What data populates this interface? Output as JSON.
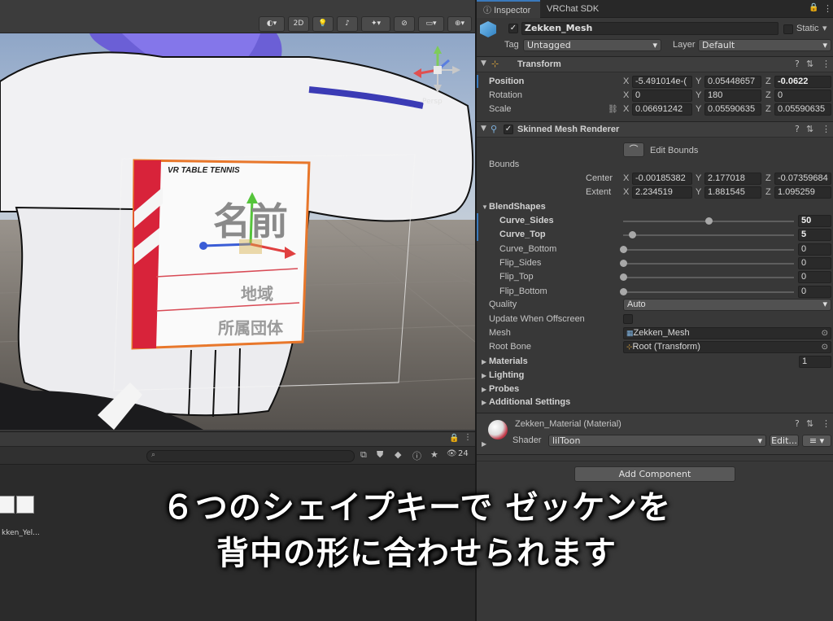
{
  "scene": {
    "toolbar": {
      "mode_2d": "2D"
    },
    "persp_label": "Persp",
    "zekken": {
      "brand": "VR TABLE TENNIS",
      "name_text": "名前",
      "region_text": "地域",
      "group_text": "所属団体"
    }
  },
  "project": {
    "asset_name": "kken_Yel...",
    "visibility_count": "24"
  },
  "inspector": {
    "tabs": [
      "Inspector",
      "VRChat SDK"
    ],
    "object": {
      "name": "Zekken_Mesh",
      "static_label": "Static",
      "tag_label": "Tag",
      "tag_value": "Untagged",
      "layer_label": "Layer",
      "layer_value": "Default"
    },
    "transform": {
      "title": "Transform",
      "position": {
        "label": "Position",
        "x": "-5.491014e-(",
        "y": "0.05448657",
        "z": "-0.0622"
      },
      "rotation": {
        "label": "Rotation",
        "x": "0",
        "y": "180",
        "z": "0"
      },
      "scale": {
        "label": "Scale",
        "x": "0.06691242",
        "y": "0.05590635",
        "z": "0.05590635"
      }
    },
    "renderer": {
      "title": "Skinned Mesh Renderer",
      "edit_bounds": "Edit Bounds",
      "bounds": "Bounds",
      "center": {
        "label": "Center",
        "x": "-0.00185382",
        "y": "2.177018",
        "z": "-0.07359684"
      },
      "extent": {
        "label": "Extent",
        "x": "2.234519",
        "y": "1.881545",
        "z": "1.095259"
      },
      "blendshapes_title": "BlendShapes",
      "blendshapes": [
        {
          "name": "Curve_Sides",
          "value": "50",
          "level": 0.5
        },
        {
          "name": "Curve_Top",
          "value": "5",
          "level": 0.05
        },
        {
          "name": "Curve_Bottom",
          "value": "0",
          "level": 0
        },
        {
          "name": "Flip_Sides",
          "value": "0",
          "level": 0
        },
        {
          "name": "Flip_Top",
          "value": "0",
          "level": 0
        },
        {
          "name": "Flip_Bottom",
          "value": "0",
          "level": 0
        }
      ],
      "quality": {
        "label": "Quality",
        "value": "Auto"
      },
      "update_offscreen": "Update When Offscreen",
      "mesh": {
        "label": "Mesh",
        "value": "Zekken_Mesh"
      },
      "root_bone": {
        "label": "Root Bone",
        "value": "Root (Transform)"
      },
      "materials": {
        "label": "Materials",
        "value": "1"
      },
      "lighting": "Lighting",
      "probes": "Probes",
      "additional": "Additional Settings"
    },
    "material": {
      "title": "Zekken_Material (Material)",
      "shader_label": "Shader",
      "shader_value": "lilToon",
      "edit_label": "Edit..."
    },
    "add_component": "Add Component"
  },
  "caption": {
    "line1": "６つのシェイプキーで ゼッケンを",
    "line2": "背中の形に合わせられます"
  },
  "colors": {
    "accent": "#3a79bb",
    "zekken_red": "#d8233a",
    "zekken_outline": "#e8772b"
  }
}
